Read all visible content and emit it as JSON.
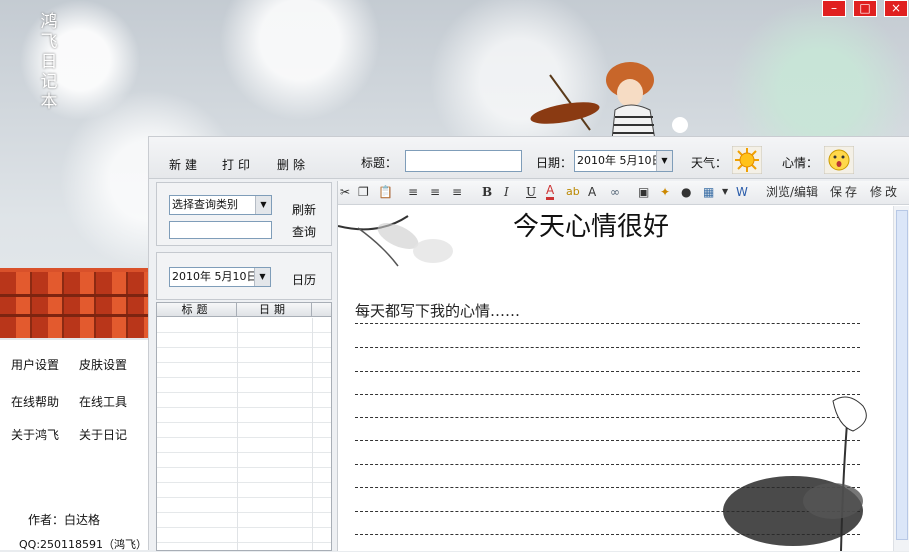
{
  "app": {
    "title_vertical": [
      "鸿",
      "飞",
      "日",
      "记",
      "本"
    ]
  },
  "window_controls": {
    "minimize": "–",
    "maximize": "□",
    "close": "×"
  },
  "left_menu": {
    "user_settings": "用户设置",
    "skin_settings": "皮肤设置",
    "online_help": "在线帮助",
    "online_tools": "在线工具",
    "about_hongfei": "关于鸿飞",
    "about_diary": "关于日记",
    "author": "作者：白达格",
    "qq": "QQ:250118591（鸿飞）"
  },
  "topbar": {
    "new": "新建",
    "print": "打印",
    "delete": "删除",
    "title_label": "标题：",
    "title_value": "",
    "date_label": "日期：",
    "date_value": "2010年 5月10日",
    "weather_label": "天气：",
    "mood_label": "心情："
  },
  "search": {
    "category_value": "选择查询类别",
    "refresh": "刷新",
    "query": "查询",
    "query_input": "",
    "date_value": "2010年 5月10日",
    "calendar": "日历"
  },
  "list": {
    "columns": [
      "标题",
      "日期"
    ],
    "rows": []
  },
  "editor_toolbar": {
    "icons": [
      "cut-icon",
      "copy-icon",
      "paste-icon",
      "align-left-icon",
      "align-center-icon",
      "align-right-icon",
      "bold-icon",
      "italic-icon",
      "underline-icon",
      "font-color-icon",
      "highlight-icon",
      "font-size-icon",
      "link-icon",
      "image-icon",
      "special-icon",
      "compass-icon",
      "table-icon",
      "dropdown-icon",
      "word-icon"
    ],
    "bold": "B",
    "italic": "I",
    "underline": "U",
    "font_color": "A",
    "font_size": "A",
    "browse_edit": "浏览/编辑",
    "save": "保存",
    "modify": "修改"
  },
  "document": {
    "title": "今天心情很好",
    "body": "每天都写下我的心情……"
  },
  "colors": {
    "close_button": "#e02020",
    "roof_tile": "#d9512a",
    "selection_border": "#7f9db9"
  }
}
